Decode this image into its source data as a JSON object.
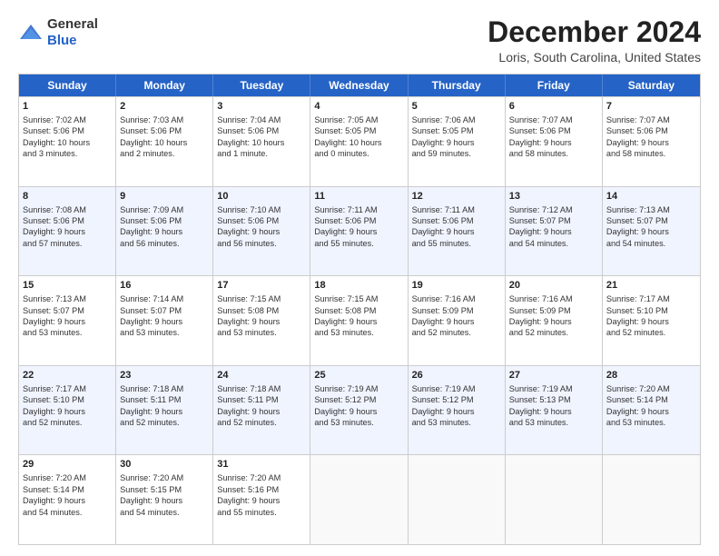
{
  "logo": {
    "general": "General",
    "blue": "Blue"
  },
  "header": {
    "month": "December 2024",
    "location": "Loris, South Carolina, United States"
  },
  "days": [
    "Sunday",
    "Monday",
    "Tuesday",
    "Wednesday",
    "Thursday",
    "Friday",
    "Saturday"
  ],
  "rows": [
    [
      {
        "day": "1",
        "lines": [
          "Sunrise: 7:02 AM",
          "Sunset: 5:06 PM",
          "Daylight: 10 hours",
          "and 3 minutes."
        ]
      },
      {
        "day": "2",
        "lines": [
          "Sunrise: 7:03 AM",
          "Sunset: 5:06 PM",
          "Daylight: 10 hours",
          "and 2 minutes."
        ]
      },
      {
        "day": "3",
        "lines": [
          "Sunrise: 7:04 AM",
          "Sunset: 5:06 PM",
          "Daylight: 10 hours",
          "and 1 minute."
        ]
      },
      {
        "day": "4",
        "lines": [
          "Sunrise: 7:05 AM",
          "Sunset: 5:05 PM",
          "Daylight: 10 hours",
          "and 0 minutes."
        ]
      },
      {
        "day": "5",
        "lines": [
          "Sunrise: 7:06 AM",
          "Sunset: 5:05 PM",
          "Daylight: 9 hours",
          "and 59 minutes."
        ]
      },
      {
        "day": "6",
        "lines": [
          "Sunrise: 7:07 AM",
          "Sunset: 5:06 PM",
          "Daylight: 9 hours",
          "and 58 minutes."
        ]
      },
      {
        "day": "7",
        "lines": [
          "Sunrise: 7:07 AM",
          "Sunset: 5:06 PM",
          "Daylight: 9 hours",
          "and 58 minutes."
        ]
      }
    ],
    [
      {
        "day": "8",
        "lines": [
          "Sunrise: 7:08 AM",
          "Sunset: 5:06 PM",
          "Daylight: 9 hours",
          "and 57 minutes."
        ]
      },
      {
        "day": "9",
        "lines": [
          "Sunrise: 7:09 AM",
          "Sunset: 5:06 PM",
          "Daylight: 9 hours",
          "and 56 minutes."
        ]
      },
      {
        "day": "10",
        "lines": [
          "Sunrise: 7:10 AM",
          "Sunset: 5:06 PM",
          "Daylight: 9 hours",
          "and 56 minutes."
        ]
      },
      {
        "day": "11",
        "lines": [
          "Sunrise: 7:11 AM",
          "Sunset: 5:06 PM",
          "Daylight: 9 hours",
          "and 55 minutes."
        ]
      },
      {
        "day": "12",
        "lines": [
          "Sunrise: 7:11 AM",
          "Sunset: 5:06 PM",
          "Daylight: 9 hours",
          "and 55 minutes."
        ]
      },
      {
        "day": "13",
        "lines": [
          "Sunrise: 7:12 AM",
          "Sunset: 5:07 PM",
          "Daylight: 9 hours",
          "and 54 minutes."
        ]
      },
      {
        "day": "14",
        "lines": [
          "Sunrise: 7:13 AM",
          "Sunset: 5:07 PM",
          "Daylight: 9 hours",
          "and 54 minutes."
        ]
      }
    ],
    [
      {
        "day": "15",
        "lines": [
          "Sunrise: 7:13 AM",
          "Sunset: 5:07 PM",
          "Daylight: 9 hours",
          "and 53 minutes."
        ]
      },
      {
        "day": "16",
        "lines": [
          "Sunrise: 7:14 AM",
          "Sunset: 5:07 PM",
          "Daylight: 9 hours",
          "and 53 minutes."
        ]
      },
      {
        "day": "17",
        "lines": [
          "Sunrise: 7:15 AM",
          "Sunset: 5:08 PM",
          "Daylight: 9 hours",
          "and 53 minutes."
        ]
      },
      {
        "day": "18",
        "lines": [
          "Sunrise: 7:15 AM",
          "Sunset: 5:08 PM",
          "Daylight: 9 hours",
          "and 53 minutes."
        ]
      },
      {
        "day": "19",
        "lines": [
          "Sunrise: 7:16 AM",
          "Sunset: 5:09 PM",
          "Daylight: 9 hours",
          "and 52 minutes."
        ]
      },
      {
        "day": "20",
        "lines": [
          "Sunrise: 7:16 AM",
          "Sunset: 5:09 PM",
          "Daylight: 9 hours",
          "and 52 minutes."
        ]
      },
      {
        "day": "21",
        "lines": [
          "Sunrise: 7:17 AM",
          "Sunset: 5:10 PM",
          "Daylight: 9 hours",
          "and 52 minutes."
        ]
      }
    ],
    [
      {
        "day": "22",
        "lines": [
          "Sunrise: 7:17 AM",
          "Sunset: 5:10 PM",
          "Daylight: 9 hours",
          "and 52 minutes."
        ]
      },
      {
        "day": "23",
        "lines": [
          "Sunrise: 7:18 AM",
          "Sunset: 5:11 PM",
          "Daylight: 9 hours",
          "and 52 minutes."
        ]
      },
      {
        "day": "24",
        "lines": [
          "Sunrise: 7:18 AM",
          "Sunset: 5:11 PM",
          "Daylight: 9 hours",
          "and 52 minutes."
        ]
      },
      {
        "day": "25",
        "lines": [
          "Sunrise: 7:19 AM",
          "Sunset: 5:12 PM",
          "Daylight: 9 hours",
          "and 53 minutes."
        ]
      },
      {
        "day": "26",
        "lines": [
          "Sunrise: 7:19 AM",
          "Sunset: 5:12 PM",
          "Daylight: 9 hours",
          "and 53 minutes."
        ]
      },
      {
        "day": "27",
        "lines": [
          "Sunrise: 7:19 AM",
          "Sunset: 5:13 PM",
          "Daylight: 9 hours",
          "and 53 minutes."
        ]
      },
      {
        "day": "28",
        "lines": [
          "Sunrise: 7:20 AM",
          "Sunset: 5:14 PM",
          "Daylight: 9 hours",
          "and 53 minutes."
        ]
      }
    ],
    [
      {
        "day": "29",
        "lines": [
          "Sunrise: 7:20 AM",
          "Sunset: 5:14 PM",
          "Daylight: 9 hours",
          "and 54 minutes."
        ]
      },
      {
        "day": "30",
        "lines": [
          "Sunrise: 7:20 AM",
          "Sunset: 5:15 PM",
          "Daylight: 9 hours",
          "and 54 minutes."
        ]
      },
      {
        "day": "31",
        "lines": [
          "Sunrise: 7:20 AM",
          "Sunset: 5:16 PM",
          "Daylight: 9 hours",
          "and 55 minutes."
        ]
      },
      {
        "day": "",
        "lines": []
      },
      {
        "day": "",
        "lines": []
      },
      {
        "day": "",
        "lines": []
      },
      {
        "day": "",
        "lines": []
      }
    ]
  ]
}
